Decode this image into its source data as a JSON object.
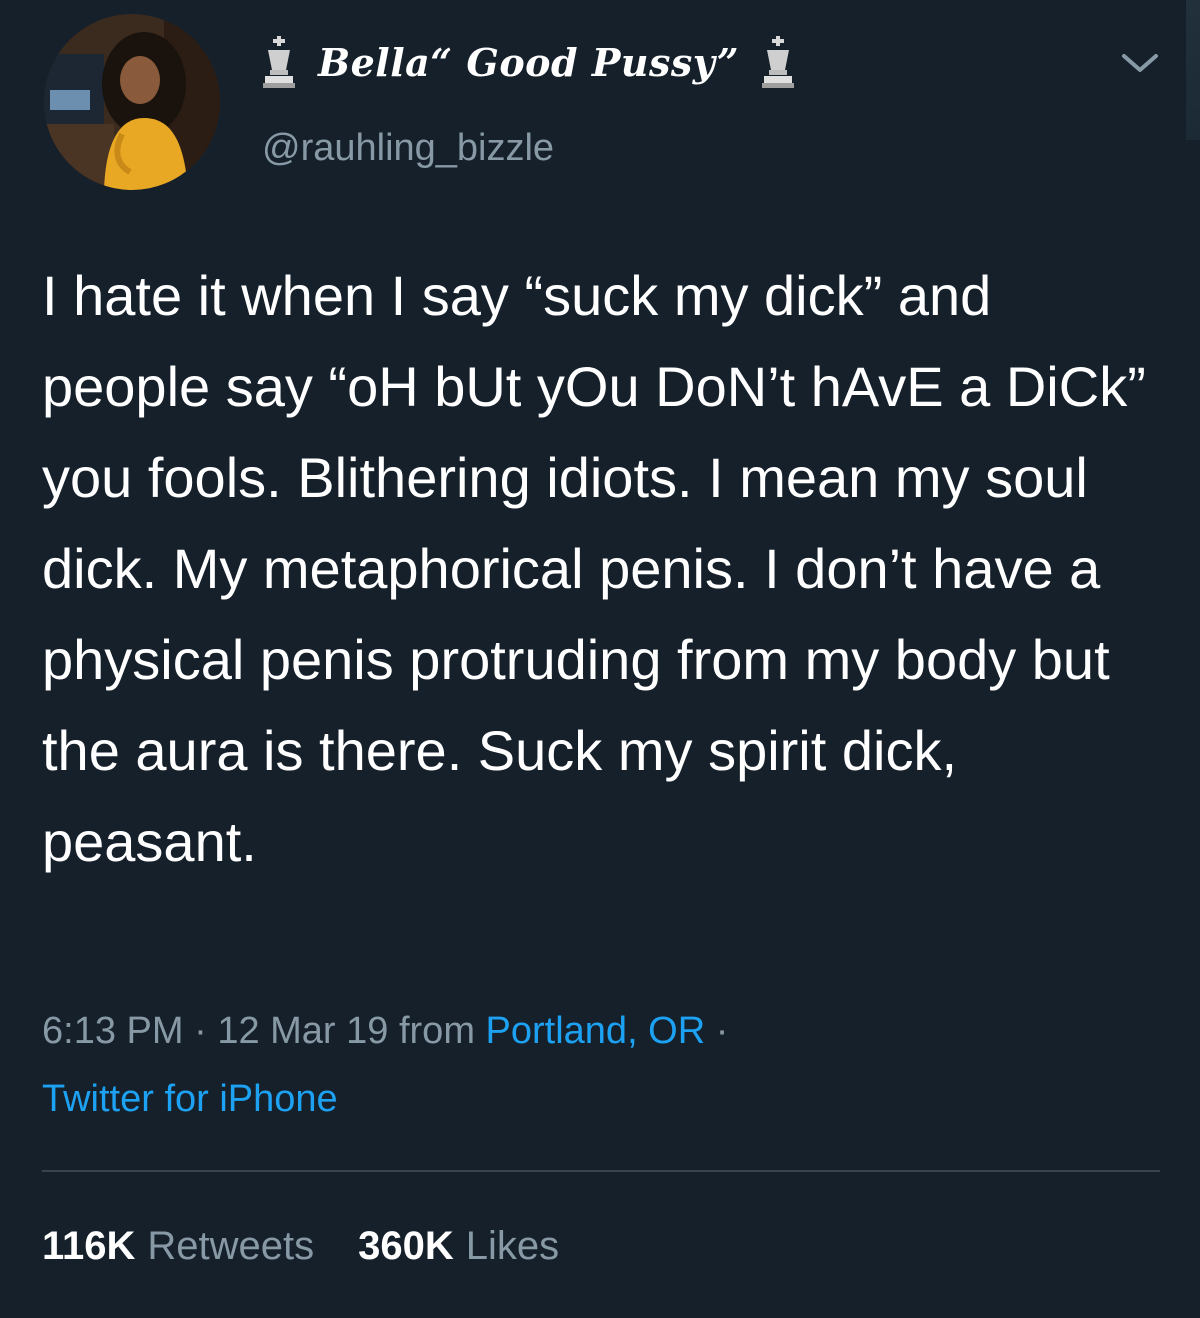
{
  "author": {
    "display_name": "Bella“ Good Pussy”",
    "handle": "@rauhling_bizzle",
    "avatar_icon": "profile-photo",
    "badge_icon": "chess-king-icon"
  },
  "tweet": {
    "text": "I hate it when I say “suck my dick” and people say “oH bUt yOu DoN’t hAvE a DiCk” you fools. Blithering idiots. I mean my soul dick. My metaphorical penis. I don’t have a physical penis protruding from my body but the aura is there. Suck my spirit dick, peasant."
  },
  "meta": {
    "time": "6:13 PM",
    "separator": "·",
    "date": "12 Mar 19",
    "from_label": "from",
    "location": "Portland, OR",
    "trailing_separator": "·",
    "source": "Twitter for iPhone"
  },
  "stats": {
    "retweets_count": "116K",
    "retweets_label": "Retweets",
    "likes_count": "360K",
    "likes_label": "Likes"
  },
  "colors": {
    "background": "#15202b",
    "text_primary": "#ffffff",
    "text_secondary": "#8899a6",
    "link": "#1da1f2",
    "divider": "#38444d"
  }
}
